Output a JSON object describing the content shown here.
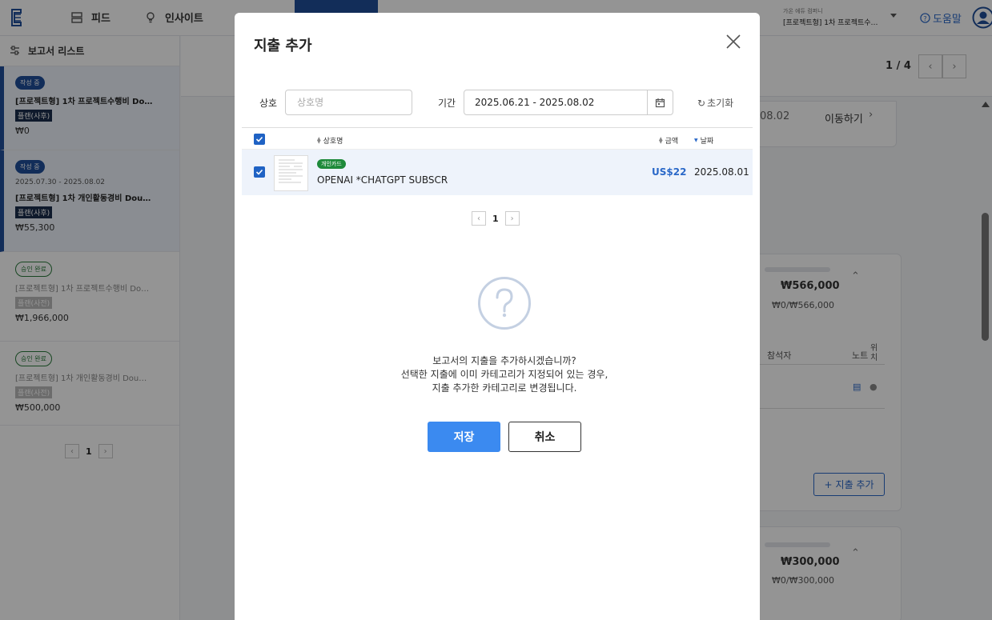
{
  "nav": {
    "feed_label": "피드",
    "insight_label": "인사이트",
    "company_label": "가온 에듀 컴퍼니",
    "company_value": "[프로젝트형] 1차 프로젝트수…",
    "help_label": "도움말"
  },
  "sidebar": {
    "title": "보고서 리스트",
    "reports": [
      {
        "status": "작성 중",
        "date": "",
        "title": "[프로젝트형] 1차 프로젝트수행비 Do…",
        "policy": "플랜(사후)",
        "amount": "₩0"
      },
      {
        "status": "작성 중",
        "date": "2025.07.30 - 2025.08.02",
        "title": "[프로젝트형] 1차 개인활동경비 Dou…",
        "policy": "플랜(사후)",
        "amount": "₩55,300"
      },
      {
        "status": "승인 완료",
        "date": "",
        "title": "[프로젝트형] 1차 프로젝트수행비 Do…",
        "policy": "플랜(사전)",
        "amount": "₩1,966,000"
      },
      {
        "status": "승인 완료",
        "date": "",
        "title": "[프로젝트형] 1차 개인활동경비 Dou…",
        "policy": "플랜(사전)",
        "amount": "₩500,000"
      }
    ],
    "page": "1"
  },
  "main": {
    "page_indicator": "1 / 4",
    "date_fragment": "08.02",
    "move_label": "이동하기",
    "card1_total": "₩566,000",
    "card1_sub": "₩0/₩566,000",
    "col_attendee": "참석자",
    "col_note": "노트",
    "col_location": "위치",
    "add_expense_label": "지출 추가",
    "card2_total": "₩300,000",
    "card2_sub": "₩0/₩300,000"
  },
  "modal": {
    "title": "지출 추가",
    "merchant_label": "상호",
    "merchant_placeholder": "상호명",
    "period_label": "기간",
    "period_value": "2025.06.21 - 2025.08.02",
    "reset_label": "초기화",
    "columns": {
      "merchant": "상호명",
      "amount": "금액",
      "date": "날짜"
    },
    "rows": [
      {
        "card": "개인카드",
        "merchant": "OPENAI *CHATGPT SUBSCR",
        "amount": "US$22",
        "date": "2025.08.01"
      }
    ],
    "page": "1"
  },
  "confirm": {
    "line1": "보고서의 지출을 추가하시겠습니까?",
    "line2": "선택한 지출에 이미 카테고리가 지정되어 있는 경우,",
    "line3": "지출 추가한 카테고리로 변경됩니다.",
    "save_label": "저장",
    "cancel_label": "취소"
  },
  "colors": {
    "primary": "#1f4e9a",
    "accent": "#3b8af0",
    "link": "#2a68c8",
    "card_chip": "#1e8a3a"
  }
}
